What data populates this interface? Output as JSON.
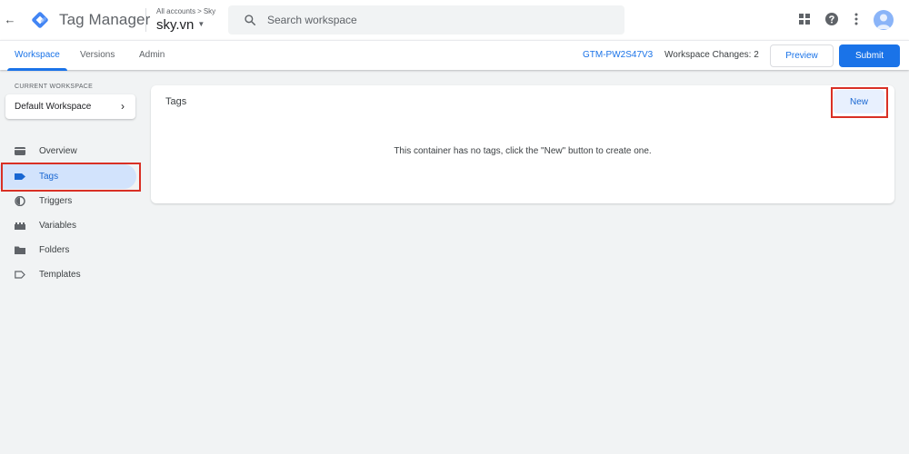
{
  "header": {
    "back_icon": "arrow-left-icon",
    "logo_icon": "tag-manager-logo",
    "app_name": "Tag Manager",
    "breadcrumb": {
      "account": "All accounts",
      "separator": ">",
      "current": "Sky"
    },
    "container_name": "sky.vn",
    "search": {
      "placeholder": "Search workspace",
      "value": ""
    },
    "icons": [
      "apps-grid-icon",
      "help-icon",
      "more-vert-icon",
      "avatar"
    ]
  },
  "subnav": {
    "tabs": [
      {
        "label": "Workspace",
        "active": true
      },
      {
        "label": "Versions",
        "active": false
      },
      {
        "label": "Admin",
        "active": false
      }
    ],
    "container_id": "GTM-PW2S47V3",
    "workspace_changes": "Workspace Changes: 2",
    "preview_label": "Preview",
    "submit_label": "Submit"
  },
  "sidebar": {
    "current_workspace_label": "CURRENT WORKSPACE",
    "workspace_name": "Default Workspace",
    "items": [
      {
        "label": "Overview",
        "icon": "overview-icon",
        "active": false
      },
      {
        "label": "Tags",
        "icon": "tag-icon",
        "active": true
      },
      {
        "label": "Triggers",
        "icon": "trigger-icon",
        "active": false
      },
      {
        "label": "Variables",
        "icon": "variables-icon",
        "active": false
      },
      {
        "label": "Folders",
        "icon": "folder-icon",
        "active": false
      },
      {
        "label": "Templates",
        "icon": "template-icon",
        "active": false
      }
    ]
  },
  "main": {
    "title": "Tags",
    "new_label": "New",
    "empty_message": "This container has no tags, click the \"New\" button to create one."
  },
  "colors": {
    "accent": "#1a73e8",
    "active_nav_bg": "#d2e3fc",
    "highlight": "#d93025",
    "background": "#f1f3f4"
  }
}
